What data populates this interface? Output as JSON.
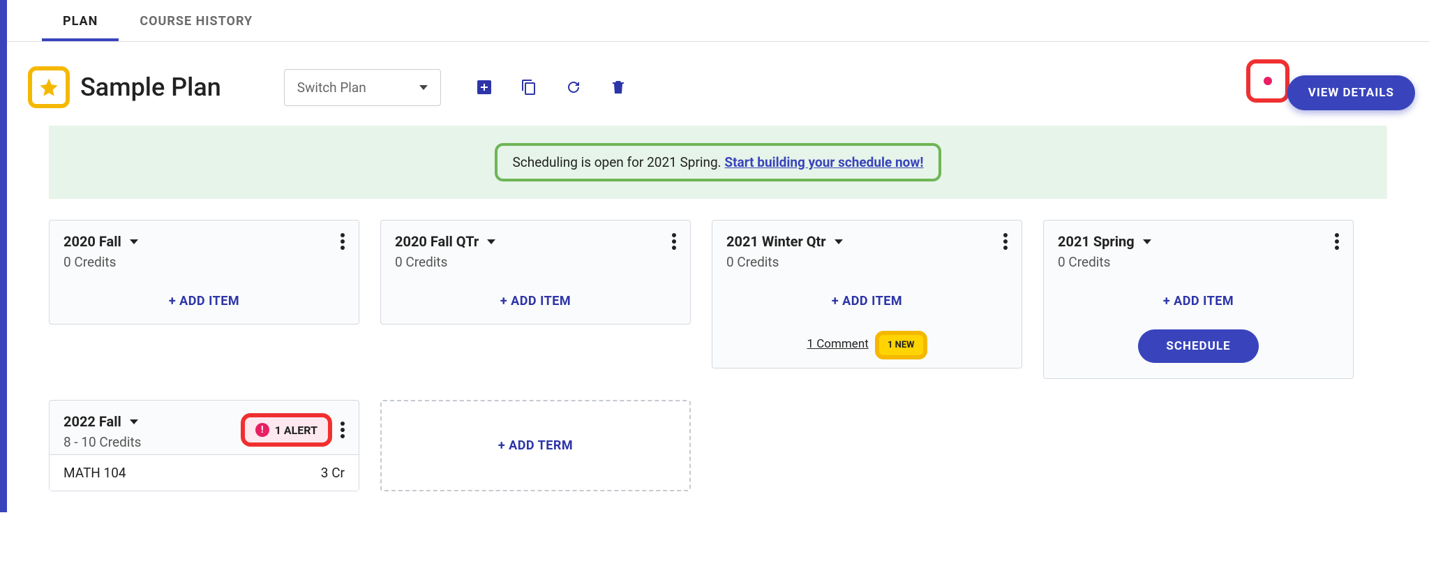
{
  "tabs": {
    "plan": "PLAN",
    "history": "COURSE HISTORY"
  },
  "planTitle": "Sample Plan",
  "switchPlanLabel": "Switch Plan",
  "viewDetailsLabel": "VIEW DETAILS",
  "banner": {
    "text": "Scheduling is open for 2021 Spring. ",
    "link": "Start building your schedule now!"
  },
  "addItemLabel": "+ ADD ITEM",
  "addTermLabel": "+ ADD TERM",
  "scheduleLabel": "SCHEDULE",
  "terms": [
    {
      "title": "2020 Fall",
      "credits": "0 Credits"
    },
    {
      "title": "2020 Fall QTr",
      "credits": "0 Credits"
    },
    {
      "title": "2021 Winter Qtr",
      "credits": "0 Credits",
      "commentText": "1 Comment",
      "newBadge": "1 NEW"
    },
    {
      "title": "2021 Spring",
      "credits": "0 Credits",
      "hasSchedule": true
    }
  ],
  "term5": {
    "title": "2022 Fall",
    "credits": "8 - 10 Credits",
    "alertText": "1 ALERT",
    "course": {
      "code": "MATH 104",
      "cr": "3 Cr"
    }
  }
}
